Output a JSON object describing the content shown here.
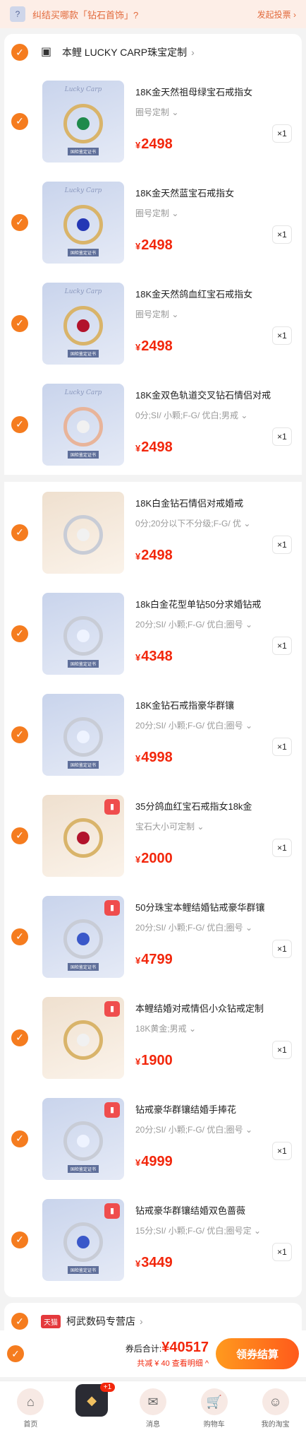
{
  "topbar": {
    "question": "纠结买哪款「钻石首饰」?",
    "action": "发起投票 ›"
  },
  "stores": [
    {
      "name": "本鲤 LUCKY CARP珠宝定制",
      "items": [
        {
          "title": "18K金天然祖母绿宝石戒指女",
          "spec": "圈号定制",
          "price": "2498",
          "qty": "×1",
          "gem": "#1f8a4c",
          "ring": "gold",
          "brand": "Lucky Carp",
          "tag": "国检鉴定证书",
          "hot": false
        },
        {
          "title": "18K金天然蓝宝石戒指女",
          "spec": "圈号定制",
          "price": "2498",
          "qty": "×1",
          "gem": "#2437b5",
          "ring": "gold",
          "brand": "Lucky Carp",
          "tag": "国检鉴定证书",
          "hot": false
        },
        {
          "title": "18K金天然鸽血红宝石戒指女",
          "spec": "圈号定制",
          "price": "2498",
          "qty": "×1",
          "gem": "#b2132c",
          "ring": "gold",
          "brand": "Lucky Carp",
          "tag": "国检鉴定证书",
          "hot": false
        },
        {
          "title": "18K金双色轨道交叉钻石情侣对戒",
          "spec": "0分;SI/ 小颗;F-G/ 优白;男戒",
          "price": "2498",
          "qty": "×1",
          "gem": "#f1f1f1",
          "ring": "rose",
          "brand": "Lucky Carp",
          "tag": "国检鉴定证书",
          "hot": false
        },
        {
          "title": "18K白金钻石情侣对戒婚戒",
          "spec": "0分;20分以下不分级;F-G/ 优",
          "price": "2498",
          "qty": "×1",
          "gem": "#f1f1f1",
          "ring": "silver",
          "brand": "",
          "tag": "",
          "hot": false,
          "warm": true
        },
        {
          "title": "18k白金花型单钻50分求婚钻戒",
          "spec": "20分;SI/ 小颗;F-G/ 优白;圈号",
          "price": "4348",
          "qty": "×1",
          "gem": "#eef3ff",
          "ring": "silver",
          "brand": "",
          "tag": "国检鉴定证书",
          "hot": false
        },
        {
          "title": "18K金钻石戒指豪华群镶",
          "spec": "20分;SI/ 小颗;F-G/ 优白;圈号",
          "price": "4998",
          "qty": "×1",
          "gem": "#eef3ff",
          "ring": "silver",
          "brand": "",
          "tag": "国检鉴定证书",
          "hot": false
        },
        {
          "title": "35分鸽血红宝石戒指女18k金",
          "spec": "宝石大小可定制",
          "price": "2000",
          "qty": "×1",
          "gem": "#b2132c",
          "ring": "gold",
          "brand": "",
          "tag": "",
          "hot": true,
          "warm": true
        },
        {
          "title": "50分珠宝本鲤结婚钻戒豪华群镶",
          "spec": "20分;SI/ 小颗;F-G/ 优白;圈号",
          "price": "4799",
          "qty": "×1",
          "gem": "#3a58c9",
          "ring": "silver",
          "brand": "",
          "tag": "国检鉴定证书",
          "hot": true
        },
        {
          "title": "本鲤结婚对戒情侣小众钻戒定制",
          "spec": "18K黄金;男戒",
          "price": "1900",
          "qty": "×1",
          "gem": "#f1f1f1",
          "ring": "gold",
          "brand": "",
          "tag": "",
          "hot": true,
          "warm": true
        },
        {
          "title": "钻戒豪华群镶结婚手捧花",
          "spec": "20分;SI/ 小颗;F-G/ 优白;圈号",
          "price": "4999",
          "qty": "×1",
          "gem": "#eef3ff",
          "ring": "silver",
          "brand": "",
          "tag": "国检鉴定证书",
          "hot": true
        },
        {
          "title": "钻戒豪华群镶结婚双色蔷薇",
          "spec": "15分;SI/ 小颗;F-G/ 优白;圈号定",
          "price": "3449",
          "qty": "×1",
          "gem": "#3a58c9",
          "ring": "silver",
          "brand": "",
          "tag": "国检鉴定证书",
          "hot": true
        }
      ]
    },
    {
      "name": "柯武数码专营店",
      "badge": "天猫",
      "items": []
    }
  ],
  "bottombar": {
    "total_label": "券后合计:",
    "total_value": "¥40517",
    "discount": "共减 ¥ 40  查看明细 ^",
    "pay_label": "领券结算"
  },
  "tabs": [
    {
      "label": "首页",
      "icon": "home-icon",
      "glyph": "⌂"
    },
    {
      "label": "",
      "icon": "promo-icon",
      "glyph": "◆",
      "badge": "+1",
      "center": true
    },
    {
      "label": "消息",
      "icon": "message-icon",
      "glyph": "✉"
    },
    {
      "label": "购物车",
      "icon": "cart-icon",
      "glyph": "🛒"
    },
    {
      "label": "我的淘宝",
      "icon": "profile-icon",
      "glyph": "☺"
    }
  ],
  "colors": {
    "accent": "#f57c1f",
    "price": "#f2270c"
  }
}
